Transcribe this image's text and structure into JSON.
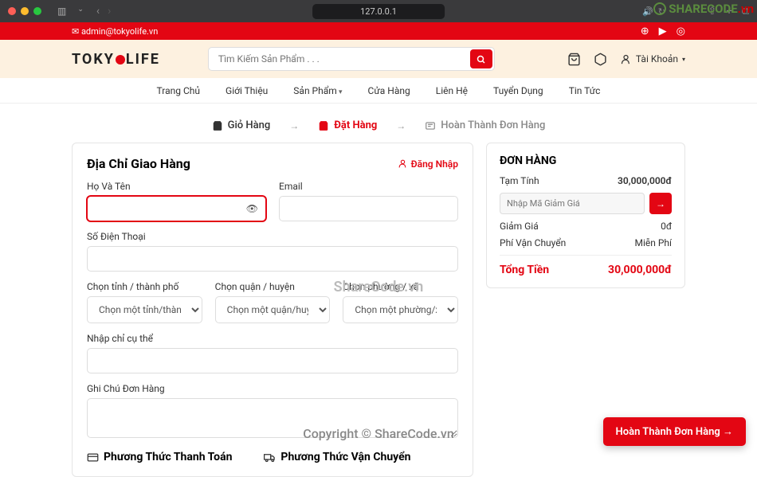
{
  "browser": {
    "url": "127.0.0.1",
    "sidebar_icon": "▤",
    "back": "‹",
    "forward": "›",
    "share": "⇧",
    "plus": "+",
    "tabs": "⧉"
  },
  "watermark": {
    "brand": "SHARECODE",
    "suffix": ".vn",
    "center": "ShareCode.vn",
    "bottom": "Copyright © ShareCode.vn"
  },
  "topbar": {
    "email": "admin@tokyolife.vn"
  },
  "logo": {
    "pre": "TOKY",
    "post": "LIFE"
  },
  "search": {
    "placeholder": "Tìm Kiếm Sản Phẩm . . ."
  },
  "account": {
    "label": "Tài Khoản"
  },
  "nav": {
    "items": [
      "Trang Chủ",
      "Giới Thiệu",
      "Sản Phẩm",
      "Cửa Hàng",
      "Liên Hệ",
      "Tuyển Dụng",
      "Tin Tức"
    ]
  },
  "steps": {
    "cart": "Giỏ Hàng",
    "checkout": "Đặt Hàng",
    "complete": "Hoàn Thành Đơn Hàng"
  },
  "form": {
    "title": "Địa Chỉ Giao Hàng",
    "login": "Đăng Nhập",
    "fullname": "Họ Và Tên",
    "email": "Email",
    "phone": "Số Điện Thoại",
    "province": "Chọn tỉnh / thành phố",
    "province_ph": "Chọn một tỉnh/thành phố",
    "district": "Chọn quận / huyện",
    "district_ph": "Chọn một quận/huyện",
    "ward": "Chọn phường / xã",
    "ward_ph": "Chọn một phường/xã",
    "address": "Nhập chỉ cụ thể",
    "note": "Ghi Chú Đơn Hàng",
    "payment_title": "Phương Thức Thanh Toán",
    "shipping_title": "Phương Thức Vận Chuyển"
  },
  "order": {
    "title": "ĐƠN HÀNG",
    "subtotal_label": "Tạm Tính",
    "subtotal_value": "30,000,000đ",
    "coupon_ph": "Nhập Mã Giảm Giá",
    "discount_label": "Giảm Giá",
    "discount_value": "0đ",
    "ship_label": "Phí Vận Chuyển",
    "ship_value": "Miễn Phí",
    "total_label": "Tổng Tiền",
    "total_value": "30,000,000đ"
  },
  "float_btn": "Hoàn Thành Đơn Hàng →"
}
